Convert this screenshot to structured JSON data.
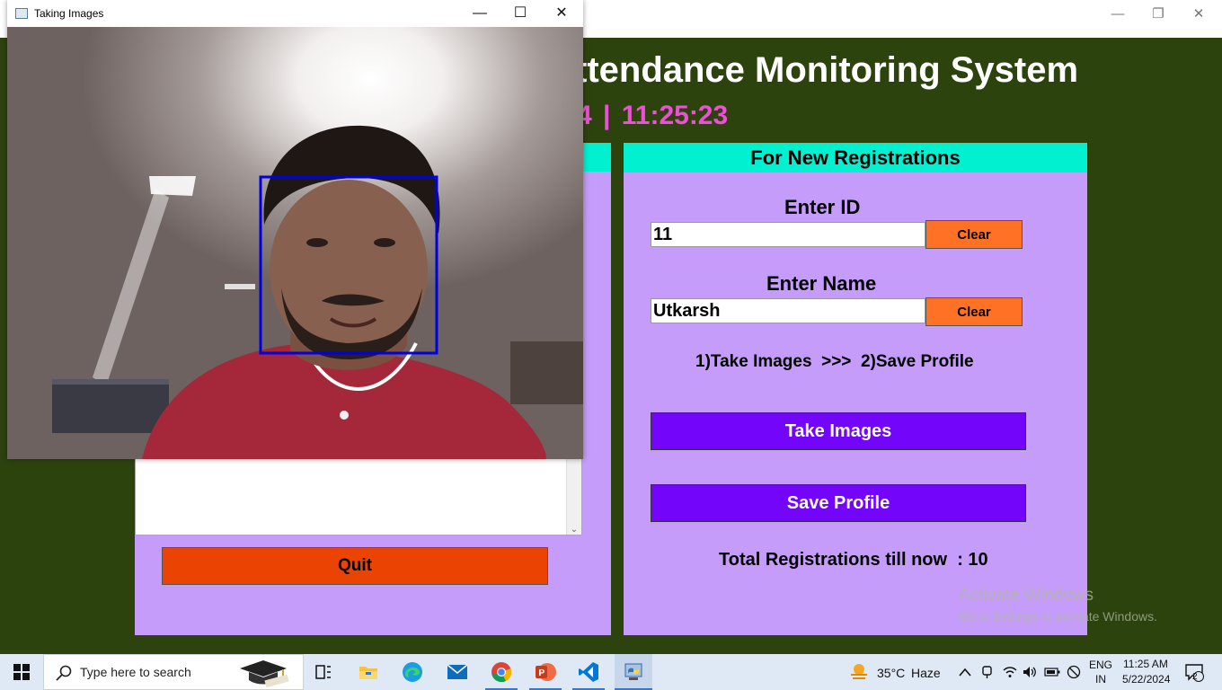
{
  "app": {
    "title": "ttendance Monitoring System",
    "clock": "4  |  11:25:23",
    "window_controls": {
      "minimize": "—",
      "maximize": "❐",
      "close": "✕"
    }
  },
  "left_panel": {
    "quit_label": "Quit",
    "scroll_arrow": "⌄"
  },
  "right_panel": {
    "header": "For New Registrations",
    "id_label": "Enter ID",
    "id_value": "11",
    "name_label": "Enter Name",
    "name_value": "Utkarsh",
    "clear_label": "Clear",
    "instructions": "1)Take Images  >>>  2)Save Profile",
    "take_images_label": "Take Images",
    "save_profile_label": "Save Profile",
    "total_registrations": "Total Registrations till now  : 10"
  },
  "watermark": {
    "line1": "Activate Windows",
    "line2": "Go to Settings to activate Windows."
  },
  "camera_window": {
    "title": "Taking Images",
    "minimize": "—",
    "maximize": "☐",
    "close": "✕",
    "face_box_color": "#0000e0"
  },
  "taskbar": {
    "search_placeholder": "Type here to search",
    "weather_temp": "35°C",
    "weather_desc": "Haze",
    "lang_top": "ENG",
    "lang_bottom": "IN",
    "time": "11:25 AM",
    "date": "5/22/2024",
    "notification_count": "2",
    "icons": [
      "start-icon",
      "search-icon",
      "graduation-cap-icon",
      "task-view-icon",
      "file-explorer-icon",
      "edge-icon",
      "mail-icon",
      "chrome-icon",
      "powerpoint-icon",
      "vscode-icon",
      "python-icon",
      "weather-icon",
      "chevron-up-icon",
      "meet-icon",
      "wifi-icon",
      "volume-icon",
      "battery-icon",
      "no-connection-icon",
      "notification-icon"
    ]
  },
  "colors": {
    "background": "#2c430e",
    "panel": "#c59cf9",
    "header": "#00f0d0",
    "clear_button": "#ff7226",
    "quit_button": "#eb4301",
    "action_button": "#7305fa",
    "clock_text": "#ee4fd9"
  }
}
